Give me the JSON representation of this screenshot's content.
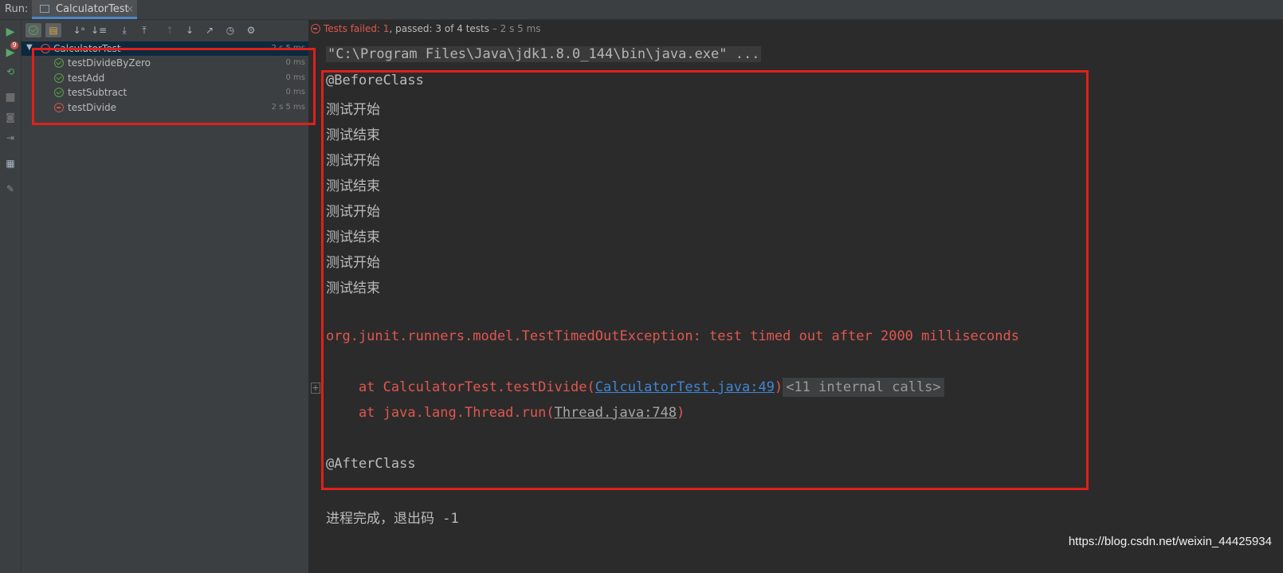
{
  "run_bar": {
    "label": "Run:",
    "tab_title": "CalculatorTest",
    "close_glyph": "×"
  },
  "side_toolbar": {
    "icons": [
      "run-icon",
      "rerun-failed-icon",
      "toggle-auto-test-icon",
      "stop-icon",
      "camera-icon",
      "export-icon",
      "layout-icon",
      "pin-icon"
    ],
    "failed_badge": "9"
  },
  "tree_toolbar": {
    "icons": [
      "show-passed-icon",
      "show-ignored-icon",
      "sort-alpha-icon",
      "sort-duration-icon",
      "expand-all-icon",
      "collapse-all-icon",
      "prev-failed-icon",
      "next-failed-icon",
      "export-results-icon",
      "history-icon",
      "settings-icon"
    ]
  },
  "tests": {
    "root": {
      "name": "CalculatorTest",
      "duration": "2 s 5 ms",
      "status": "failed"
    },
    "items": [
      {
        "name": "testDivideByZero",
        "duration": "0 ms",
        "status": "passed"
      },
      {
        "name": "testAdd",
        "duration": "0 ms",
        "status": "passed"
      },
      {
        "name": "testSubtract",
        "duration": "0 ms",
        "status": "passed"
      },
      {
        "name": "testDivide",
        "duration": "2 s 5 ms",
        "status": "failed"
      }
    ]
  },
  "status": {
    "failed_text": "Tests failed: 1",
    "sep": ", ",
    "passed_text": "passed: 3 of 4 tests",
    "duration_text": " – 2 s 5 ms"
  },
  "console": {
    "command": "\"C:\\Program Files\\Java\\jdk1.8.0_144\\bin\\java.exe\" ...",
    "before_class": "@BeforeClass",
    "start": "测试开始",
    "end": "测试结束",
    "exception": "org.junit.runners.model.TestTimedOutException: test timed out after 2000 milliseconds",
    "stack1_prefix": "    at CalculatorTest.testDivide(",
    "stack1_link": "CalculatorTest.java:49",
    "stack1_suffix": ")",
    "stack1_fold": "<11 internal calls>",
    "stack2_prefix": "    at java.lang.Thread.run(",
    "stack2_link": "Thread.java:748",
    "stack2_suffix": ")",
    "after_class": "@AfterClass",
    "exit": "进程完成，退出码 -1"
  },
  "watermark": "https://blog.csdn.net/weixin_44425934",
  "colors": {
    "accent_red": "#e0201b",
    "error_text": "#e0574f",
    "link": "#3f86d4",
    "pass": "#5a9e4c",
    "fail": "#c75450"
  }
}
